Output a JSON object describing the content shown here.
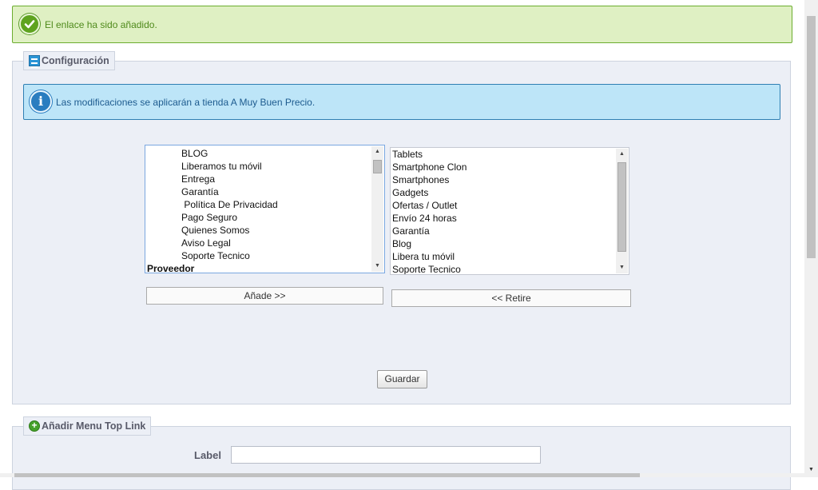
{
  "success_message": "El enlace ha sido añadido.",
  "config": {
    "legend": "Configuración",
    "legend_icon": "menu-icon",
    "info_message": "Las modificaciones se aplicarán a tienda A Muy Buen Precio."
  },
  "available_list": {
    "items": [
      {
        "label": "BLOG",
        "bold": false
      },
      {
        "label": "Liberamos tu móvil",
        "bold": false
      },
      {
        "label": "Entrega",
        "bold": false
      },
      {
        "label": "Garantía",
        "bold": false
      },
      {
        "label": " Política De Privacidad",
        "bold": false
      },
      {
        "label": "Pago Seguro",
        "bold": false
      },
      {
        "label": "Quienes Somos",
        "bold": false
      },
      {
        "label": "Aviso Legal",
        "bold": false
      },
      {
        "label": "Soporte Tecnico",
        "bold": false
      },
      {
        "label": "Proveedor",
        "bold": true
      }
    ]
  },
  "selected_list": {
    "items": [
      "Tablets",
      "Smartphone Clon",
      "Smartphones",
      "Gadgets",
      "Ofertas / Outlet",
      "Envío 24 horas",
      "Garantía",
      "Blog",
      "Libera tu móvil",
      "Soporte Tecnico"
    ]
  },
  "buttons": {
    "add": "Añade >>",
    "remove": "<< Retire",
    "save": "Guardar"
  },
  "add_link": {
    "legend": "Añadir Menu Top Link",
    "legend_icon": "plus-icon",
    "label_field_label": "Label",
    "label_value": ""
  },
  "colors": {
    "success_bg": "#dff0c3",
    "info_bg": "#bde5f8",
    "panel_bg": "#eceff6"
  }
}
